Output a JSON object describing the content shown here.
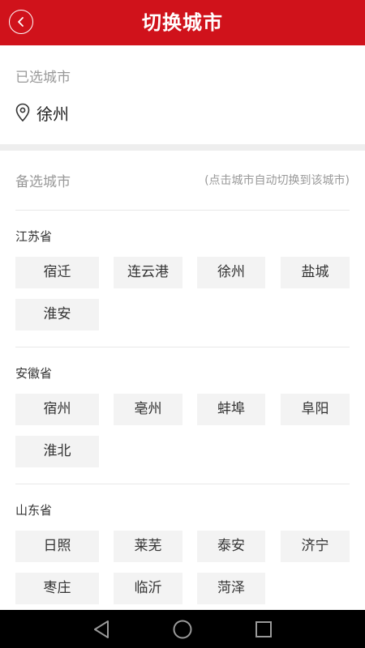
{
  "header": {
    "title": "切换城市"
  },
  "selected": {
    "label": "已选城市",
    "city": "徐州"
  },
  "candidates": {
    "label": "备选城市",
    "hint": "(点击城市自动切换到该城市)",
    "provinces": [
      {
        "name": "江苏省",
        "cities": [
          "宿迁",
          "连云港",
          "徐州",
          "盐城",
          "淮安"
        ]
      },
      {
        "name": "安徽省",
        "cities": [
          "宿州",
          "亳州",
          "蚌埠",
          "阜阳",
          "淮北"
        ]
      },
      {
        "name": "山东省",
        "cities": [
          "日照",
          "莱芜",
          "泰安",
          "济宁",
          "枣庄",
          "临沂",
          "菏泽"
        ]
      }
    ]
  }
}
